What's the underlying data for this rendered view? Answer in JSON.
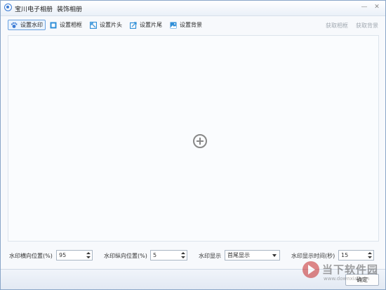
{
  "window": {
    "title": "宝川电子相册",
    "subtitle": "装饰相册",
    "minimize": "—",
    "close": "✕"
  },
  "toolbar": {
    "items": [
      {
        "label": "设置水印",
        "icon": "paw-icon",
        "active": true
      },
      {
        "label": "设置相框",
        "icon": "frame-icon"
      },
      {
        "label": "设置片头",
        "icon": "intro-icon"
      },
      {
        "label": "设置片尾",
        "icon": "outro-icon"
      },
      {
        "label": "设置背景",
        "icon": "background-icon"
      }
    ],
    "get_frame": "获取相框",
    "get_background": "获取背景"
  },
  "canvas": {
    "icon": "add-circle-icon"
  },
  "settings": {
    "h_pos_label": "水印横向位置(%)",
    "h_pos_value": "95",
    "v_pos_label": "水印纵向位置(%)",
    "v_pos_value": "5",
    "display_label": "水印显示",
    "display_value": "首尾显示",
    "duration_label": "水印显示时间(秒)",
    "duration_value": "15"
  },
  "footer": {
    "ok_label": "确定"
  },
  "watermark": {
    "cn": "当下软件园",
    "en": "www.downxia.com"
  },
  "colors": {
    "accent": "#3a7bd5",
    "active_border": "#6aa2e0"
  }
}
